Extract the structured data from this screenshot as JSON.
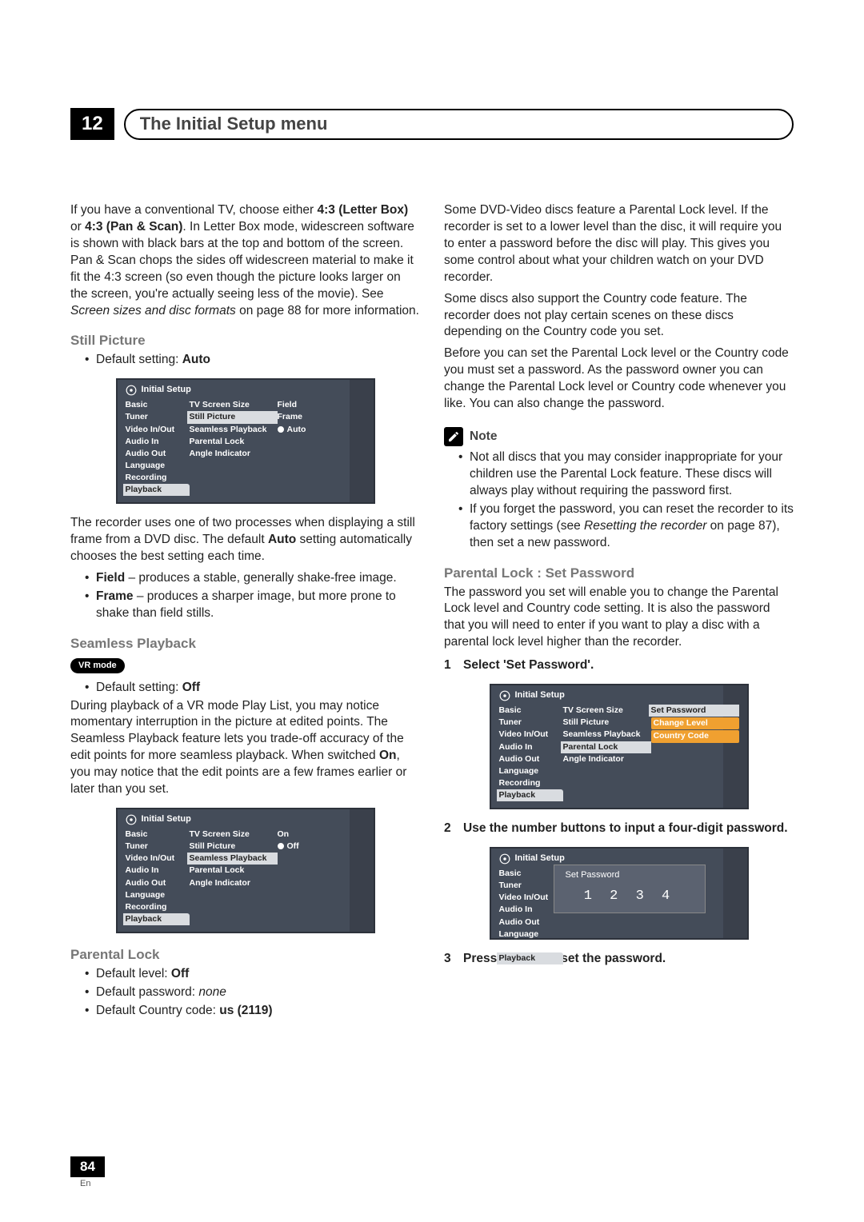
{
  "chapter": {
    "number": "12",
    "title": "The Initial Setup menu"
  },
  "left": {
    "intro_pre": "If you have a conventional TV, choose either ",
    "intro_b1": "4:3 (Letter Box)",
    "intro_mid1": " or ",
    "intro_b2": "4:3 (Pan & Scan)",
    "intro_mid2": ". In Letter Box mode, widescreen software is shown with black bars at the top and bottom of the screen. Pan & Scan chops the sides off widescreen material to make it fit the 4:3 screen (so even though the picture looks larger on the screen, you're actually seeing less of the movie). See ",
    "intro_i": "Screen sizes and disc formats",
    "intro_tail": " on page 88 for more information.",
    "still": {
      "title": "Still Picture",
      "default_pre": "Default setting: ",
      "default_val": "Auto",
      "para1_pre": "The recorder uses one of two processes when displaying a still frame from a DVD disc. The default ",
      "para1_b": "Auto",
      "para1_tail": " setting automatically chooses the best setting each time.",
      "b1_b": "Field",
      "b1_t": " – produces a stable, generally shake-free image.",
      "b2_b": "Frame",
      "b2_t": " – produces a sharper image, but more prone to shake than field stills."
    },
    "seamless": {
      "title": "Seamless Playback",
      "badge": "VR mode",
      "default_pre": "Default setting: ",
      "default_val": "Off",
      "para_pre": "During playback of a VR mode Play List, you may notice momentary interruption in the picture at edited points. The Seamless Playback feature lets you trade-off accuracy of the edit points for more seamless playback. When switched ",
      "para_b": "On",
      "para_tail": ", you may notice that the edit points are a few frames earlier or later than you set."
    },
    "parental": {
      "title": "Parental Lock",
      "d1_pre": "Default level: ",
      "d1_val": "Off",
      "d2_pre": "Default password: ",
      "d2_val": "none",
      "d3_pre": "Default Country code: ",
      "d3_val": "us (2119)"
    }
  },
  "right": {
    "p1": "Some DVD-Video discs feature a Parental Lock level. If the recorder is set to a lower level than the disc, it will require you to enter a password before the disc will play. This gives you some control about what your children watch on your DVD recorder.",
    "p2": "Some discs also support the Country code feature. The recorder does not play certain scenes on these discs depending on the Country code you set.",
    "p3": "Before you can set the Parental Lock level or the Country code you must set a password. As the password owner you can change the Parental Lock level or Country code whenever you like. You can also change the password.",
    "note_label": "Note",
    "note1": "Not all discs that you may consider inappropriate for your children use the Parental Lock feature. These discs will always play without requiring the password first.",
    "note2_pre": "If you forget the password, you can reset the recorder to its factory settings (see ",
    "note2_i": "Resetting the recorder",
    "note2_tail": " on page 87), then set a new password.",
    "setpw": {
      "title": "Parental Lock : Set Password",
      "para": "The password you set will enable you to change the Parental Lock level and Country code setting. It is also the password that you will need to enter if you want to play a disc with a parental lock level higher than the recorder.",
      "step1": "Select 'Set Password'.",
      "step2": "Use the number buttons to input a four-digit password.",
      "step3": "Press ENTER to set the password."
    }
  },
  "osd_common": {
    "header": "Initial Setup",
    "sidebar": [
      "Basic",
      "Tuner",
      "Video In/Out",
      "Audio In",
      "Audio Out",
      "Language",
      "Recording",
      "Playback"
    ],
    "playback_items": [
      "TV Screen Size",
      "Still Picture",
      "Seamless Playback",
      "Parental Lock",
      "Angle Indicator"
    ]
  },
  "osd_still": {
    "col3": [
      "Field",
      "Frame",
      "Auto"
    ],
    "selected": 2
  },
  "osd_seamless": {
    "col3": [
      "On",
      "Off"
    ],
    "selected": 1
  },
  "osd_parental": {
    "col3": [
      "Set Password",
      "Change Level",
      "Country Code"
    ],
    "hl": 0,
    "orange": [
      1,
      2
    ]
  },
  "osd_pw": {
    "popup_title": "Set Password",
    "digits": "1 2 3 4"
  },
  "footer": {
    "page": "84",
    "lang": "En"
  }
}
